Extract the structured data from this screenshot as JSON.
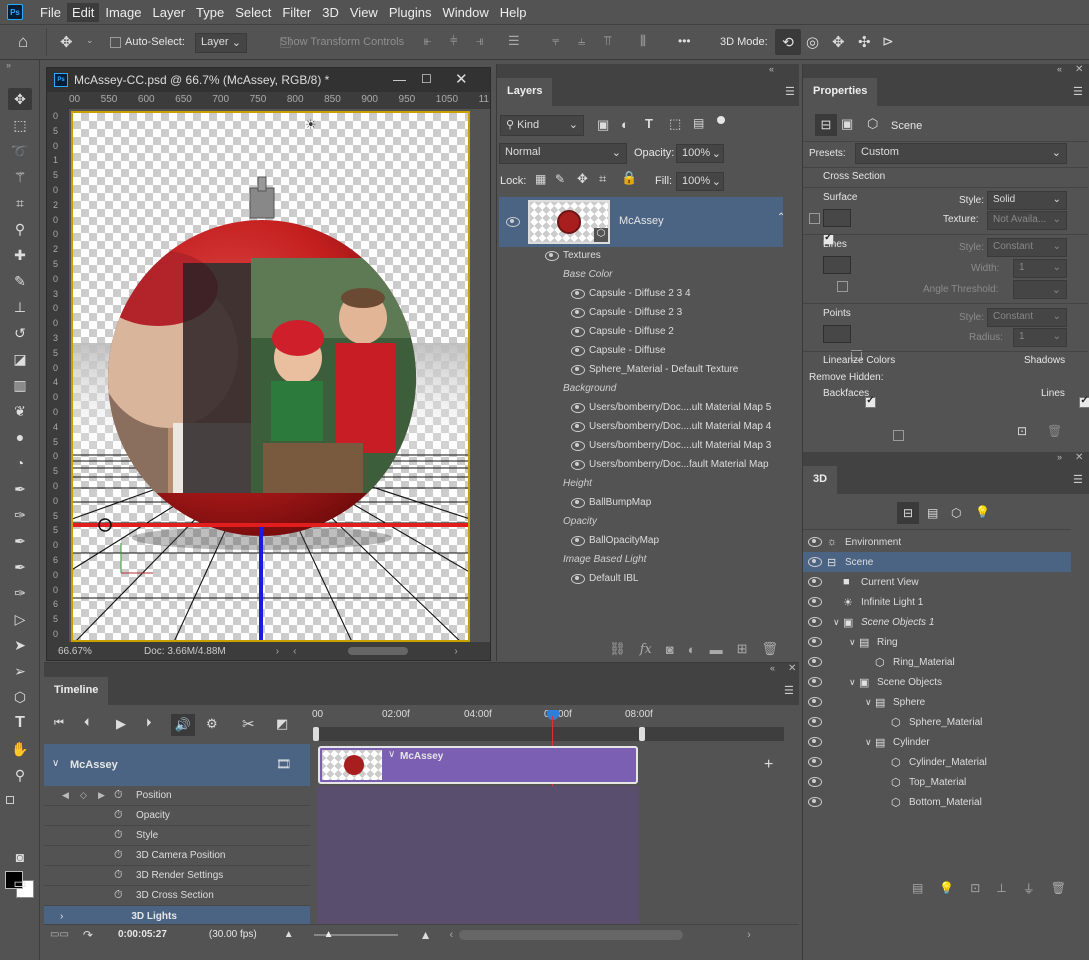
{
  "menu": {
    "logo": "Ps",
    "items": [
      "File",
      "Edit",
      "Image",
      "Layer",
      "Type",
      "Select",
      "Filter",
      "3D",
      "View",
      "Plugins",
      "Window",
      "Help"
    ],
    "active_index": 1
  },
  "options": {
    "auto_select_label": "Auto-Select:",
    "auto_select_value": "Layer",
    "show_transform_label": "Show Transform Controls",
    "more_label": "•••",
    "mode_3d_label": "3D Mode:"
  },
  "document": {
    "title": "McAssey-CC.psd @ 66.7% (McAssey, RGB/8) *",
    "ruler_h": [
      "00",
      "550",
      "600",
      "650",
      "700",
      "750",
      "800",
      "850",
      "900",
      "950",
      "1050",
      "11"
    ],
    "ruler_v": [
      "0",
      "5",
      "0",
      "1",
      "5",
      "0",
      "2",
      "0",
      "0",
      "2",
      "5",
      "0",
      "3",
      "0",
      "0",
      "3",
      "5",
      "0",
      "4",
      "0",
      "0",
      "4",
      "5",
      "0",
      "5",
      "0",
      "0",
      "5",
      "5",
      "0",
      "6",
      "0",
      "0",
      "6",
      "5",
      "0"
    ],
    "zoom": "66.67%",
    "doc_size": "Doc: 3.66M/4.88M"
  },
  "layers": {
    "tab": "Layers",
    "filter_kind": "Kind",
    "blend_mode": "Normal",
    "opacity_label": "Opacity:",
    "opacity": "100%",
    "lock_label": "Lock:",
    "fill_label": "Fill:",
    "fill": "100%",
    "layer_name": "McAssey",
    "items": [
      {
        "label": "Textures",
        "type": "group"
      },
      {
        "label": "Base Color",
        "type": "heading"
      },
      {
        "label": "Capsule - Diffuse 2 3 4",
        "type": "item"
      },
      {
        "label": "Capsule - Diffuse 2 3",
        "type": "item"
      },
      {
        "label": "Capsule - Diffuse 2",
        "type": "item"
      },
      {
        "label": "Capsule - Diffuse",
        "type": "item"
      },
      {
        "label": "Sphere_Material - Default Texture",
        "type": "item"
      },
      {
        "label": "Background",
        "type": "heading"
      },
      {
        "label": "Users/bomberry/Doc....ult Material Map 5",
        "type": "item"
      },
      {
        "label": "Users/bomberry/Doc....ult Material Map 4",
        "type": "item"
      },
      {
        "label": "Users/bomberry/Doc....ult Material Map 3",
        "type": "item"
      },
      {
        "label": "Users/bomberry/Doc...fault Material Map",
        "type": "item"
      },
      {
        "label": "Height",
        "type": "heading"
      },
      {
        "label": "BallBumpMap",
        "type": "item"
      },
      {
        "label": "Opacity",
        "type": "heading"
      },
      {
        "label": "BallOpacityMap",
        "type": "item"
      },
      {
        "label": "Image Based Light",
        "type": "heading"
      },
      {
        "label": "Default IBL",
        "type": "item"
      }
    ]
  },
  "properties": {
    "tab": "Properties",
    "scene_label": "Scene",
    "presets_label": "Presets:",
    "presets_value": "Custom",
    "cross_section": "Cross Section",
    "surface": "Surface",
    "style_label": "Style:",
    "surface_style": "Solid",
    "texture_label": "Texture:",
    "texture_value": "Not Availa...",
    "lines": "Lines",
    "lines_style": "Constant",
    "width_label": "Width:",
    "width_value": "1",
    "angle_label": "Angle Threshold:",
    "points": "Points",
    "points_style": "Constant",
    "radius_label": "Radius:",
    "radius_value": "1",
    "linearize": "Linearize Colors",
    "shadows": "Shadows",
    "remove_hidden": "Remove Hidden:",
    "backfaces": "Backfaces",
    "lines2": "Lines"
  },
  "panel3d": {
    "tab": "3D",
    "items": [
      {
        "label": "Environment",
        "indent": 0,
        "italic": false,
        "selected": false,
        "icon": "environment-icon",
        "arrow": ""
      },
      {
        "label": "Scene",
        "indent": 0,
        "italic": false,
        "selected": true,
        "icon": "scene-icon",
        "arrow": ""
      },
      {
        "label": "Current View",
        "indent": 1,
        "italic": false,
        "selected": false,
        "icon": "camera-icon",
        "arrow": ""
      },
      {
        "label": "Infinite Light 1",
        "indent": 1,
        "italic": false,
        "selected": false,
        "icon": "light-icon",
        "arrow": ""
      },
      {
        "label": "Scene Objects 1",
        "indent": 1,
        "italic": true,
        "selected": false,
        "icon": "group-icon",
        "arrow": "∨"
      },
      {
        "label": "Ring",
        "indent": 2,
        "italic": false,
        "selected": false,
        "icon": "mesh-icon",
        "arrow": "∨"
      },
      {
        "label": "Ring_Material",
        "indent": 3,
        "italic": false,
        "selected": false,
        "icon": "material-icon",
        "arrow": ""
      },
      {
        "label": "Scene Objects",
        "indent": 2,
        "italic": false,
        "selected": false,
        "icon": "group-icon",
        "arrow": "∨"
      },
      {
        "label": "Sphere",
        "indent": 3,
        "italic": false,
        "selected": false,
        "icon": "mesh-icon",
        "arrow": "∨"
      },
      {
        "label": "Sphere_Material",
        "indent": 4,
        "italic": false,
        "selected": false,
        "icon": "material-icon",
        "arrow": ""
      },
      {
        "label": "Cylinder",
        "indent": 3,
        "italic": false,
        "selected": false,
        "icon": "mesh-icon",
        "arrow": "∨"
      },
      {
        "label": "Cylinder_Material",
        "indent": 4,
        "italic": false,
        "selected": false,
        "icon": "material-icon",
        "arrow": ""
      },
      {
        "label": "Top_Material",
        "indent": 4,
        "italic": false,
        "selected": false,
        "icon": "material-icon",
        "arrow": ""
      },
      {
        "label": "Bottom_Material",
        "indent": 4,
        "italic": false,
        "selected": false,
        "icon": "material-icon",
        "arrow": ""
      }
    ]
  },
  "timeline": {
    "tab": "Timeline",
    "track_name": "McAssey",
    "clip_name": "McAssey",
    "ruler": [
      "00",
      "02:00f",
      "04:00f",
      "06:00f",
      "08:00f"
    ],
    "properties": [
      "Position",
      "Opacity",
      "Style",
      "3D Camera Position",
      "3D Render Settings",
      "3D Cross Section"
    ],
    "lights": "3D Lights",
    "timecode": "0:00:05:27",
    "fps": "(30.00 fps)"
  },
  "colors": {
    "accent": "#4b6484",
    "clip": "#7b5fb3",
    "playhead": "#e03030",
    "selected_row": "#4b6484"
  }
}
